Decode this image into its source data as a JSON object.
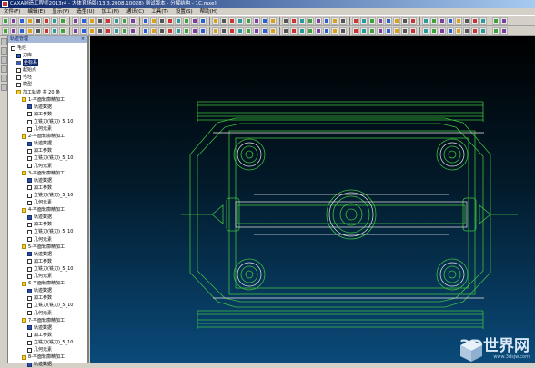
{
  "window": {
    "title": "CAXA制造工程师2013r4 - 大体育场版(13.3.2008.10028) 测试版本 - 分解结构 - 1C.mxe]"
  },
  "menu": [
    "文件(F)",
    "编辑(E)",
    "显示(V)",
    "造型(U)",
    "加工(N)",
    "通讯(C)",
    "工具(T)",
    "设置(S)",
    "帮助(H)"
  ],
  "panel": {
    "title": "轨迹管理",
    "close": "×"
  },
  "tree": [
    {
      "level": 0,
      "icon": "file",
      "label": "毛坯"
    },
    {
      "level": 1,
      "icon": "blue",
      "label": "刀库"
    },
    {
      "level": 1,
      "icon": "sel",
      "label": "坐标系",
      "hl": true
    },
    {
      "level": 1,
      "icon": "file",
      "label": "起始点"
    },
    {
      "level": 1,
      "icon": "file",
      "label": "毛坯"
    },
    {
      "level": 1,
      "icon": "file",
      "label": "模型"
    },
    {
      "level": 1,
      "icon": "folder",
      "label": "加工轨迹  共 20 条"
    },
    {
      "level": 2,
      "icon": "folder",
      "label": "1-平面轮廓精加工"
    },
    {
      "level": 3,
      "icon": "doc",
      "label": "轨迹数据"
    },
    {
      "level": 3,
      "icon": "file",
      "label": "加工参数"
    },
    {
      "level": 3,
      "icon": "file",
      "label": "立铣刀(铣刀)_5_10"
    },
    {
      "level": 3,
      "icon": "file",
      "label": "几何元素"
    },
    {
      "level": 2,
      "icon": "folder",
      "label": "2-平面轮廓精加工"
    },
    {
      "level": 3,
      "icon": "doc",
      "label": "轨迹数据"
    },
    {
      "level": 3,
      "icon": "file",
      "label": "加工参数"
    },
    {
      "level": 3,
      "icon": "file",
      "label": "立铣刀(铣刀)_5_10"
    },
    {
      "level": 3,
      "icon": "file",
      "label": "几何元素"
    },
    {
      "level": 2,
      "icon": "folder",
      "label": "3-平面轮廓精加工"
    },
    {
      "level": 3,
      "icon": "doc",
      "label": "轨迹数据"
    },
    {
      "level": 3,
      "icon": "file",
      "label": "加工参数"
    },
    {
      "level": 3,
      "icon": "file",
      "label": "立铣刀(铣刀)_5_10"
    },
    {
      "level": 3,
      "icon": "file",
      "label": "几何元素"
    },
    {
      "level": 2,
      "icon": "folder",
      "label": "4-平面轮廓精加工"
    },
    {
      "level": 3,
      "icon": "doc",
      "label": "轨迹数据"
    },
    {
      "level": 3,
      "icon": "file",
      "label": "加工参数"
    },
    {
      "level": 3,
      "icon": "file",
      "label": "立铣刀(铣刀)_5_10"
    },
    {
      "level": 3,
      "icon": "file",
      "label": "几何元素"
    },
    {
      "level": 2,
      "icon": "folder",
      "label": "5-平面轮廓精加工"
    },
    {
      "level": 3,
      "icon": "doc",
      "label": "轨迹数据"
    },
    {
      "level": 3,
      "icon": "file",
      "label": "加工参数"
    },
    {
      "level": 3,
      "icon": "file",
      "label": "立铣刀(铣刀)_5_10"
    },
    {
      "level": 3,
      "icon": "file",
      "label": "几何元素"
    },
    {
      "level": 2,
      "icon": "folder",
      "label": "6-平面轮廓精加工"
    },
    {
      "level": 3,
      "icon": "doc",
      "label": "轨迹数据"
    },
    {
      "level": 3,
      "icon": "file",
      "label": "加工参数"
    },
    {
      "level": 3,
      "icon": "file",
      "label": "立铣刀(铣刀)_5_10"
    },
    {
      "level": 3,
      "icon": "file",
      "label": "几何元素"
    },
    {
      "level": 2,
      "icon": "folder",
      "label": "7-平面轮廓精加工"
    },
    {
      "level": 3,
      "icon": "doc",
      "label": "轨迹数据"
    },
    {
      "level": 3,
      "icon": "file",
      "label": "加工参数"
    },
    {
      "level": 3,
      "icon": "file",
      "label": "立铣刀(铣刀)_5_10"
    },
    {
      "level": 3,
      "icon": "file",
      "label": "几何元素"
    },
    {
      "level": 2,
      "icon": "folder",
      "label": "8-平面轮廓精加工"
    },
    {
      "level": 3,
      "icon": "doc",
      "label": "轨迹数据"
    }
  ],
  "toolbar1_icons": 58,
  "toolbar2_icons": 58,
  "colors": {
    "geometry": "#3fbf3f",
    "highlight": "#e8e8e8",
    "canvas_top": "#000000",
    "canvas_bottom": "#0a4a7a"
  },
  "watermark": {
    "text": "3D世界网",
    "url": "www.3dsjw.com"
  }
}
